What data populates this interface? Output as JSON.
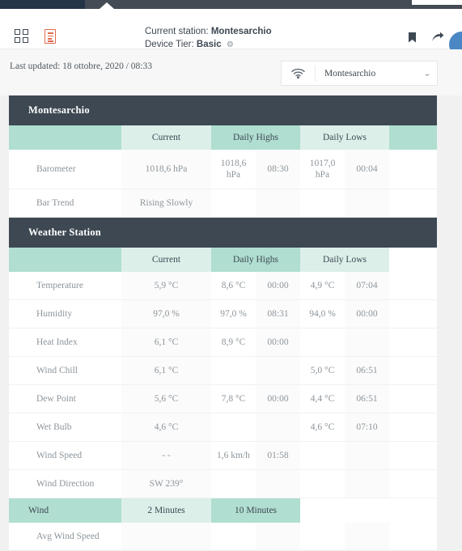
{
  "header": {
    "grid_icon": "grid-icon",
    "doc_icon": "document-icon",
    "current_station_label": "Current station:",
    "current_station_value": "Montesarchio",
    "device_tier_label": "Device Tier:",
    "device_tier_value": "Basic",
    "gear_icon": "gear-icon",
    "bookmark_icon": "bookmark-icon",
    "share_icon": "share-icon",
    "avatar": "user-avatar"
  },
  "subbar": {
    "last_updated": "Last updated: 18 ottobre, 2020 / 08:33",
    "station_select": {
      "icon": "wifi-signal-icon",
      "value": "Montesarchio",
      "chevron": "⌄"
    }
  },
  "colors": {
    "section_header": "#3d4852",
    "teal_dark": "#b0ded1",
    "teal_light": "#dcefe9",
    "accent_orange": "#e06a4e",
    "avatar_blue": "#4a87c4",
    "page_bg": "#f1f1f1"
  },
  "sections": [
    {
      "title": "Montesarchio",
      "columns": [
        "",
        "Current",
        "Daily Highs",
        "Daily Lows",
        ""
      ],
      "rows": [
        {
          "label": "Barometer",
          "current": "1018,6 hPa",
          "high": "1018,6 hPa",
          "high_time": "08:30",
          "low": "1017,0 hPa",
          "low_time": "00:04"
        },
        {
          "label": "Bar Trend",
          "current": "Rising Slowly",
          "high": "",
          "high_time": "",
          "low": "",
          "low_time": ""
        }
      ]
    },
    {
      "title": "Weather Station",
      "columns": [
        "",
        "Current",
        "Daily Highs",
        "Daily Lows",
        ""
      ],
      "rows": [
        {
          "label": "Temperature",
          "current": "5,9 °C",
          "high": "8,6 °C",
          "high_time": "00:00",
          "low": "4,9 °C",
          "low_time": "07:04"
        },
        {
          "label": "Humidity",
          "current": "97,0 %",
          "high": "97,0 %",
          "high_time": "08:31",
          "low": "94,0 %",
          "low_time": "00:00"
        },
        {
          "label": "Heat Index",
          "current": "6,1 °C",
          "high": "8,9 °C",
          "high_time": "00:00",
          "low": "",
          "low_time": ""
        },
        {
          "label": "Wind Chill",
          "current": "6,1 °C",
          "high": "",
          "high_time": "",
          "low": "5,0 °C",
          "low_time": "06:51"
        },
        {
          "label": "Dew Point",
          "current": "5,6 °C",
          "high": "7,8 °C",
          "high_time": "00:00",
          "low": "4,4 °C",
          "low_time": "06:51"
        },
        {
          "label": "Wet Bulb",
          "current": "4,6 °C",
          "high": "",
          "high_time": "",
          "low": "4,6 °C",
          "low_time": "07:10"
        },
        {
          "label": "Wind Speed",
          "current": "- -",
          "high": "1,6 km/h",
          "high_time": "01:58",
          "low": "",
          "low_time": ""
        },
        {
          "label": "Wind Direction",
          "current": "SW 239°",
          "high": "",
          "high_time": "",
          "low": "",
          "low_time": ""
        }
      ],
      "sub_header": {
        "label": "Wind",
        "col_two": "2 Minutes",
        "col_ten": "10 Minutes"
      },
      "cut_off_row": {
        "label": "Avg Wind Speed"
      }
    }
  ]
}
